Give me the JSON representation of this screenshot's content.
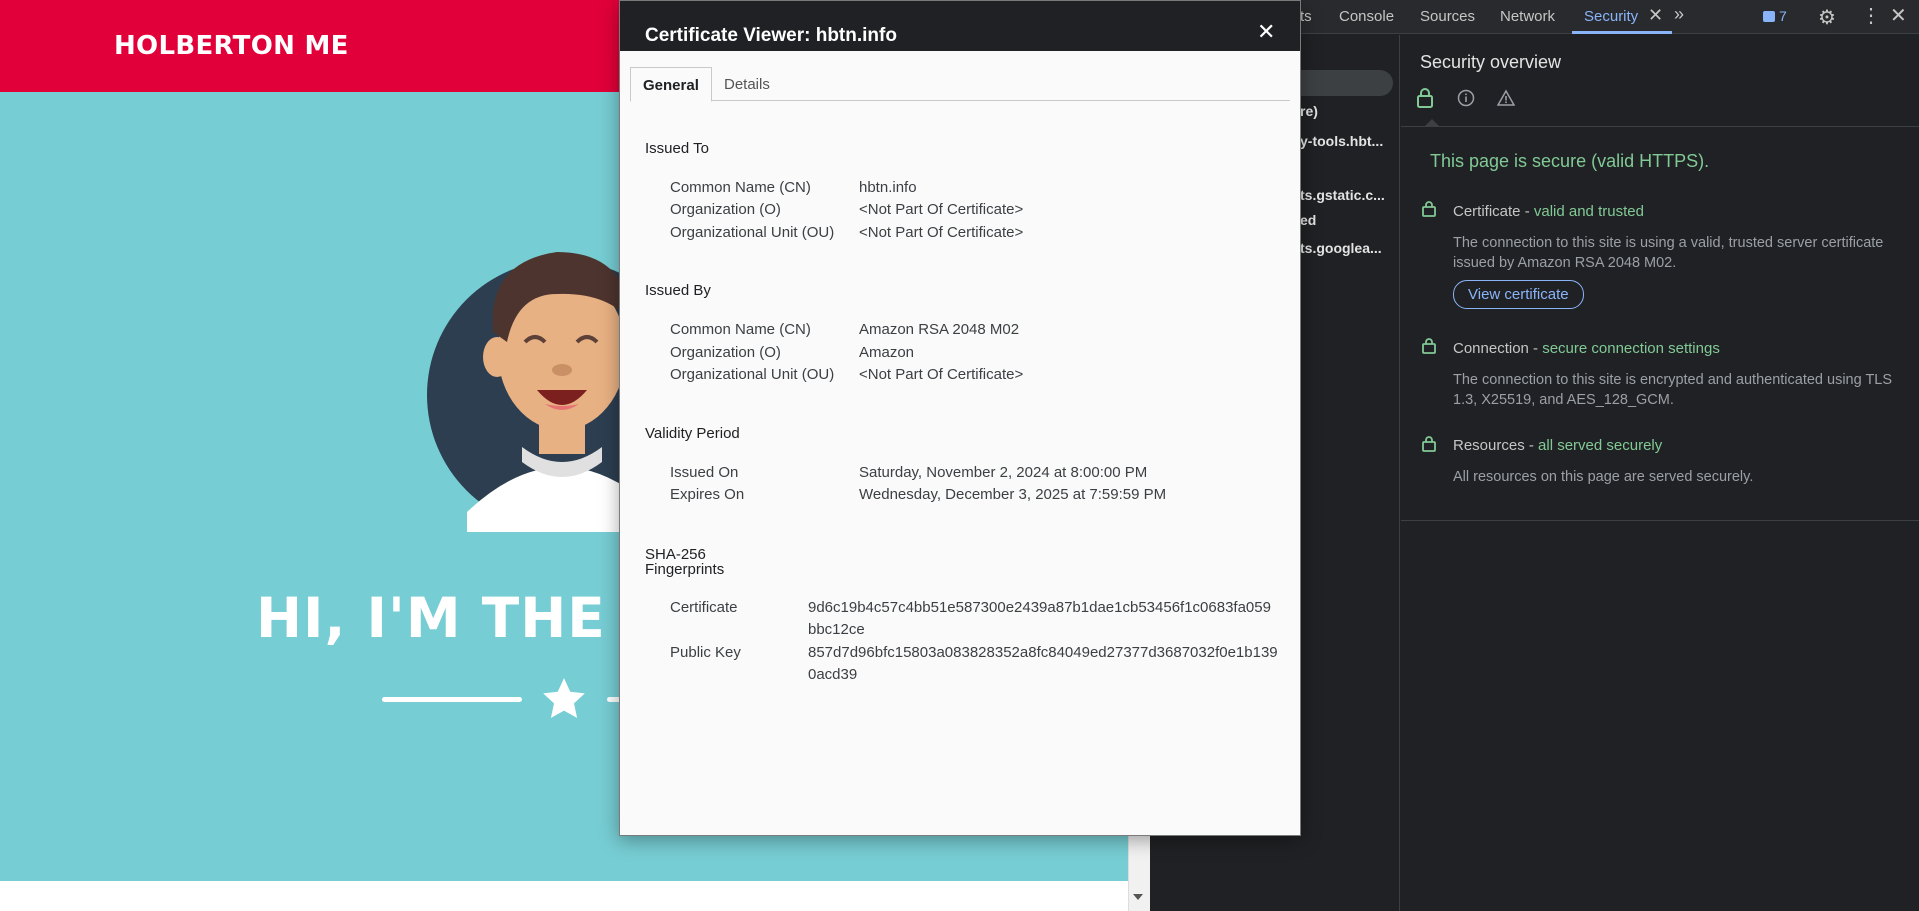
{
  "webpage": {
    "brand": "HOLBERTON ME",
    "hero_title": "HI, I'M THE C"
  },
  "devtools": {
    "tabs": {
      "partial": "ts",
      "console": "Console",
      "sources": "Sources",
      "network": "Network",
      "security": "Security"
    },
    "issues_count": "7",
    "origins": [
      "re)",
      "y-tools.hbt...",
      "ts.gstatic.c...",
      "ed",
      "ts.googlea..."
    ],
    "overview": {
      "title": "Security overview",
      "summary": "This page is secure (valid HTTPS).",
      "certificate": {
        "label": "Certificate - ",
        "status": "valid and trusted",
        "body": "The connection to this site is using a valid, trusted server certificate issued by Amazon RSA 2048 M02.",
        "button": "View certificate"
      },
      "connection": {
        "label": "Connection - ",
        "status": "secure connection settings",
        "body": "The connection to this site is encrypted and authenticated using TLS 1.3, X25519, and AES_128_GCM."
      },
      "resources": {
        "label": "Resources - ",
        "status": "all served securely",
        "body": "All resources on this page are served securely."
      }
    },
    "colors": {
      "accent": "#8ab4f8",
      "secure": "#81c995",
      "brand": "#e10039",
      "hero_bg": "#76cdd3"
    }
  },
  "cert_viewer": {
    "title": "Certificate Viewer: hbtn.info",
    "tabs": {
      "general": "General",
      "details": "Details"
    },
    "issued_to": {
      "heading": "Issued To",
      "cn_label": "Common Name (CN)",
      "cn": "hbtn.info",
      "o_label": "Organization (O)",
      "o": "<Not Part Of Certificate>",
      "ou_label": "Organizational Unit (OU)",
      "ou": "<Not Part Of Certificate>"
    },
    "issued_by": {
      "heading": "Issued By",
      "cn_label": "Common Name (CN)",
      "cn": "Amazon RSA 2048 M02",
      "o_label": "Organization (O)",
      "o": "Amazon",
      "ou_label": "Organizational Unit (OU)",
      "ou": "<Not Part Of Certificate>"
    },
    "validity": {
      "heading": "Validity Period",
      "issued_label": "Issued On",
      "issued": "Saturday, November 2, 2024 at 8:00:00 PM",
      "expires_label": "Expires On",
      "expires": "Wednesday, December 3, 2025 at 7:59:59 PM"
    },
    "fingerprints": {
      "heading_line1": "SHA-256",
      "heading_line2": "Fingerprints",
      "cert_label": "Certificate",
      "cert": "9d6c19b4c57c4bb51e587300e2439a87b1dae1cb53456f1c0683fa059bbc12ce",
      "pk_label": "Public Key",
      "pk": "857d7d96bfc15803a083828352a8fc84049ed27377d3687032f0e1b1390acd39"
    }
  }
}
